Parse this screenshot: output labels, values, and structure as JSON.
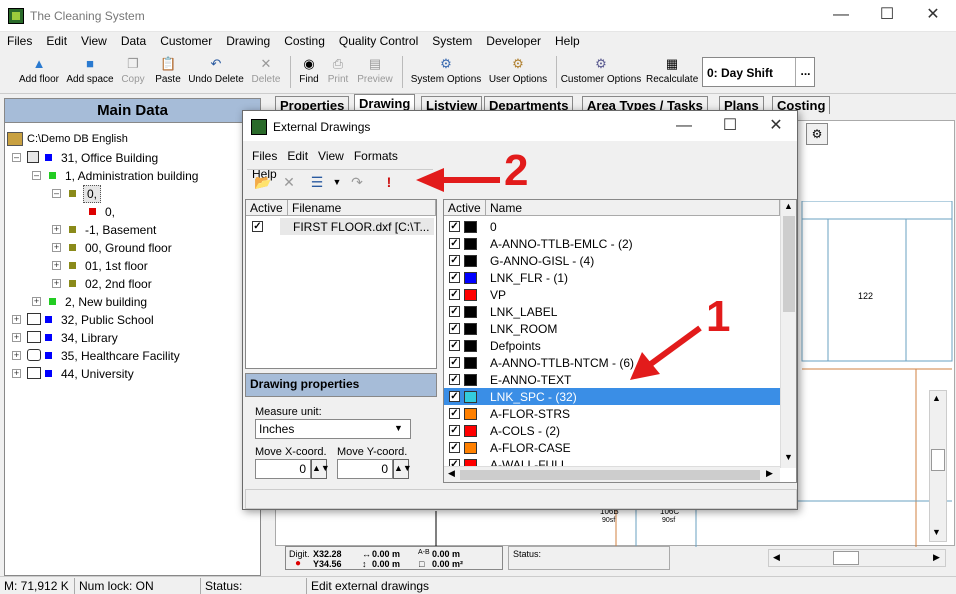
{
  "app": {
    "title": "The Cleaning System"
  },
  "menu": [
    "Files",
    "Edit",
    "View",
    "Data",
    "Customer",
    "Drawing",
    "Costing",
    "Quality Control",
    "System",
    "Developer",
    "Help"
  ],
  "toolbar": {
    "buttons": [
      {
        "label": "Add floor",
        "icon": "add-floor-icon",
        "enabled": true
      },
      {
        "label": "Add space",
        "icon": "add-space-icon",
        "enabled": true
      },
      {
        "label": "Copy",
        "icon": "copy-icon",
        "enabled": false
      },
      {
        "label": "Paste",
        "icon": "paste-icon",
        "enabled": true
      },
      {
        "label": "Undo Delete",
        "icon": "undo-icon",
        "enabled": true
      },
      {
        "label": "Delete",
        "icon": "delete-icon",
        "enabled": false
      },
      {
        "label": "Find",
        "icon": "binoculars-icon",
        "enabled": true
      },
      {
        "label": "Print",
        "icon": "print-icon",
        "enabled": false
      },
      {
        "label": "Preview",
        "icon": "preview-icon",
        "enabled": false
      },
      {
        "label": "System Options",
        "icon": "system-options-icon",
        "enabled": true
      },
      {
        "label": "User Options",
        "icon": "user-options-icon",
        "enabled": true
      },
      {
        "label": "Customer Options",
        "icon": "customer-options-icon",
        "enabled": true
      },
      {
        "label": "Recalculate",
        "icon": "calculator-icon",
        "enabled": true
      }
    ],
    "shift_value": "0: Day Shift",
    "shift_button": "..."
  },
  "main_data": {
    "header": "Main Data",
    "tree": [
      {
        "label": "C:\\Demo DB English"
      },
      {
        "label": "31, Office Building"
      },
      {
        "label": "1, Administration building"
      },
      {
        "label": "0,"
      },
      {
        "label": "0,"
      },
      {
        "label": "-1, Basement"
      },
      {
        "label": "00, Ground floor"
      },
      {
        "label": "01, 1st floor"
      },
      {
        "label": "02, 2nd floor"
      },
      {
        "label": "2, New building"
      },
      {
        "label": "32, Public School"
      },
      {
        "label": "34, Library"
      },
      {
        "label": "35, Healthcare Facility"
      },
      {
        "label": "44, University"
      }
    ]
  },
  "tabs": [
    "Properties",
    "Drawing",
    "Listview",
    "Departments",
    "Area Types / Tasks",
    "Plans",
    "Costing"
  ],
  "drawing": {
    "room_122": "122",
    "room_106b": "106B",
    "room_106c": "106C",
    "area_a": "90sf",
    "area_b": "90sf",
    "digit_label": "Digit.",
    "x_value": "X32.28",
    "y_value": "Y34.56",
    "horiz_len": "0.00 m",
    "vert_len": "0.00 m",
    "ab_len": "0.00 m",
    "area_val": "0.00 m²",
    "status_label": "Status:"
  },
  "status_bar": {
    "memory": "M: 71,912 K",
    "numlock": "Num lock: ON",
    "status": "Status:",
    "message": "Edit external drawings"
  },
  "dialog": {
    "title": "External Drawings",
    "menu": [
      "Files",
      "Edit",
      "View",
      "Formats",
      "Help"
    ],
    "files": {
      "col_active": "Active",
      "col_filename": "Filename",
      "rows": [
        {
          "active": true,
          "filename": "FIRST FLOOR.dxf  [C:\\T..."
        }
      ]
    },
    "props": {
      "header": "Drawing properties",
      "measure_label": "Measure unit:",
      "measure_value": "Inches",
      "move_x_label": "Move X-coord.",
      "move_y_label": "Move Y-coord.",
      "move_x_value": "0",
      "move_y_value": "0"
    },
    "layers": {
      "col_active": "Active",
      "col_name": "Name",
      "rows": [
        {
          "name": "0",
          "color": "#000000",
          "active": true
        },
        {
          "name": "A-ANNO-TTLB-EMLC - (2)",
          "color": "#000000",
          "active": true
        },
        {
          "name": "G-ANNO-GISL - (4)",
          "color": "#000000",
          "active": true
        },
        {
          "name": "LNK_FLR - (1)",
          "color": "#0000ff",
          "active": true
        },
        {
          "name": "VP",
          "color": "#ff0000",
          "active": true
        },
        {
          "name": "LNK_LABEL",
          "color": "#000000",
          "active": true
        },
        {
          "name": "LNK_ROOM",
          "color": "#000000",
          "active": true
        },
        {
          "name": "Defpoints",
          "color": "#000000",
          "active": true
        },
        {
          "name": "A-ANNO-TTLB-NTCM - (6)",
          "color": "#000000",
          "active": true
        },
        {
          "name": "E-ANNO-TEXT",
          "color": "#000000",
          "active": true
        },
        {
          "name": "LNK_SPC - (32)",
          "color": "#33ccdd",
          "active": true,
          "selected": true
        },
        {
          "name": "A-FLOR-STRS",
          "color": "#ff8000",
          "active": true
        },
        {
          "name": "A-COLS - (2)",
          "color": "#ff0000",
          "active": true
        },
        {
          "name": "A-FLOR-CASE",
          "color": "#ff8000",
          "active": true
        },
        {
          "name": "A-WALL-FULL",
          "color": "#ff0000",
          "active": true
        }
      ]
    }
  },
  "annotations": {
    "one": "1",
    "two": "2",
    "arrow_color": "#e21b1b"
  }
}
